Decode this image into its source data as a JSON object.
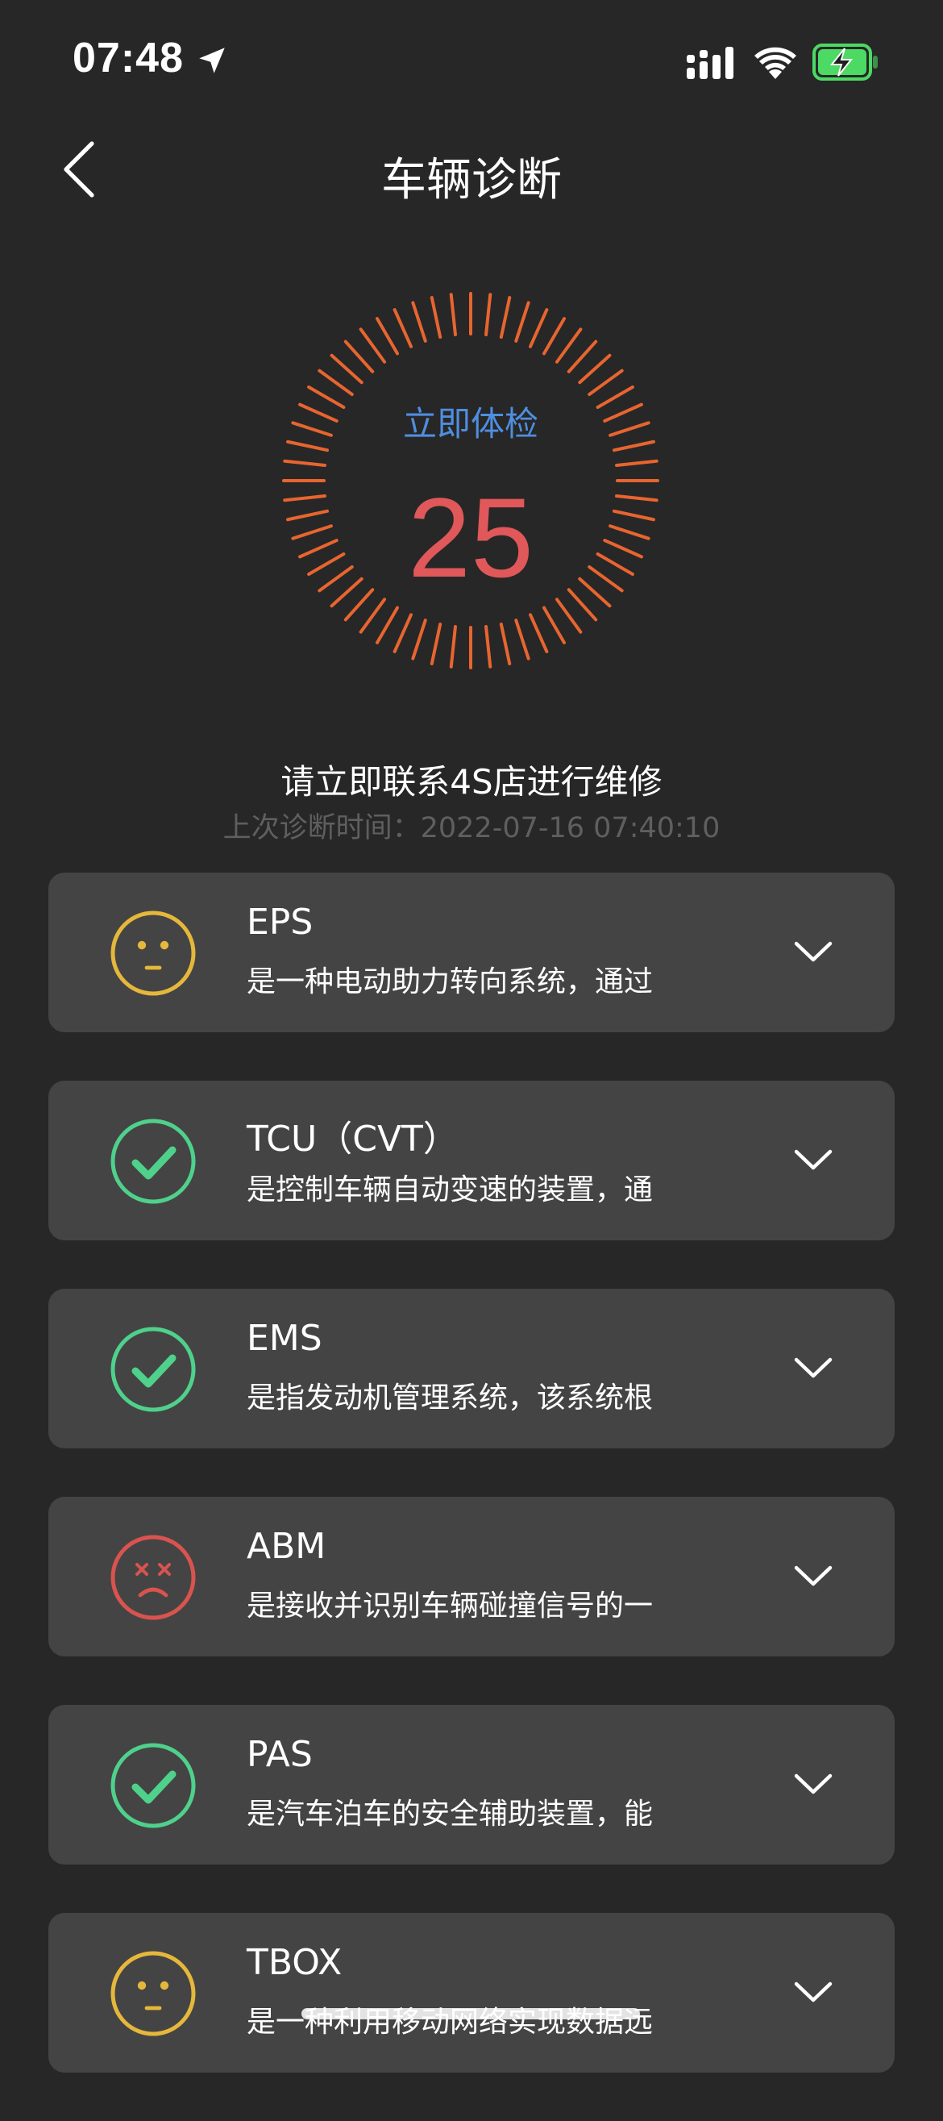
{
  "status_bar": {
    "time": "07:48",
    "icons": [
      "location-icon",
      "signal-icon",
      "wifi-icon",
      "battery-charging-icon"
    ],
    "battery_color": "#4cd964"
  },
  "header": {
    "title": "车辆诊断",
    "back_icon": "chevron-left-icon"
  },
  "gauge": {
    "action_label": "立即体检",
    "score": "25",
    "tick_color": "#e8652f",
    "score_color": "#e0585a",
    "action_color": "#4f8ee0"
  },
  "summary": {
    "message": "请立即联系4S店进行维修",
    "last_diagnosis": "上次诊断时间：2022-07-16 07:40:10"
  },
  "items": [
    {
      "title": "EPS",
      "description": "是一种电动助力转向系统，通过",
      "status": "warning",
      "icon": "neutral-face-icon"
    },
    {
      "title": "TCU（CVT）",
      "description": "是控制车辆自动变速的装置，通",
      "status": "ok",
      "icon": "check-icon"
    },
    {
      "title": "EMS",
      "description": "是指发动机管理系统，该系统根",
      "status": "ok",
      "icon": "check-icon"
    },
    {
      "title": "ABM",
      "description": "是接收并识别车辆碰撞信号的一",
      "status": "error",
      "icon": "dizzy-face-icon"
    },
    {
      "title": "PAS",
      "description": "是汽车泊车的安全辅助装置，能",
      "status": "ok",
      "icon": "check-icon"
    },
    {
      "title": "TBOX",
      "description": "是一种利用移动网络实现数据远",
      "status": "warning",
      "icon": "neutral-face-icon"
    }
  ],
  "colors": {
    "warning": "#e5b73b",
    "ok": "#4fd18b",
    "error": "#d9534f",
    "card_bg": "#444444",
    "page_bg": "#272727"
  }
}
